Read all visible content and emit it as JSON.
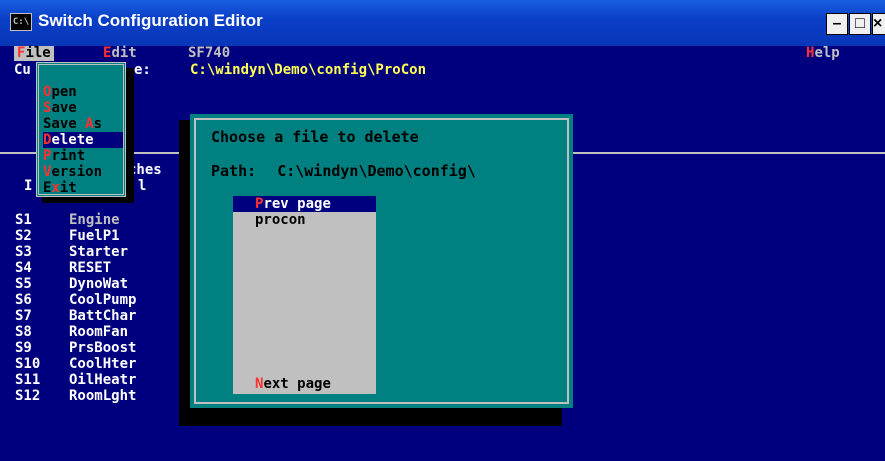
{
  "window": {
    "title": "Switch Configuration Editor",
    "icon_text": "C:\\",
    "minimize_glyph": "–",
    "maximize_glyph": "□",
    "close_glyph": "×"
  },
  "menubar": {
    "file": "File",
    "edit": "Edit",
    "model": "SF740",
    "help": "Help"
  },
  "current": {
    "label_left": "Cu",
    "label_right": "e:",
    "path": "C:\\windyn\\Demo\\config\\ProCon"
  },
  "file_menu": {
    "items": [
      "Open",
      "Save",
      "Save As",
      "Delete",
      "Print",
      "Version",
      "Exit"
    ],
    "selected": "Delete"
  },
  "background_labels": {
    "ches": "ches",
    "i": "I",
    "l": "l"
  },
  "switches": [
    {
      "id": "S1",
      "name": "Engine"
    },
    {
      "id": "S2",
      "name": "FuelP1"
    },
    {
      "id": "S3",
      "name": "Starter"
    },
    {
      "id": "S4",
      "name": "RESET"
    },
    {
      "id": "S5",
      "name": "DynoWat"
    },
    {
      "id": "S6",
      "name": "CoolPump"
    },
    {
      "id": "S7",
      "name": "BattChar"
    },
    {
      "id": "S8",
      "name": "RoomFan"
    },
    {
      "id": "S9",
      "name": "PrsBoost"
    },
    {
      "id": "S10",
      "name": "CoolHter"
    },
    {
      "id": "S11",
      "name": "OilHeatr"
    },
    {
      "id": "S12",
      "name": "RoomLght"
    }
  ],
  "dialog": {
    "heading": "Choose a file to delete",
    "path_label": "Path:",
    "path_value": "C:\\windyn\\Demo\\config\\",
    "prev": "Prev page",
    "files": [
      "procon"
    ],
    "next": "Next page"
  },
  "colors": {
    "console_bg": "#00007f",
    "menu_bg": "#008080",
    "hotkey": "#ff3030",
    "path_text": "#ffff55"
  }
}
